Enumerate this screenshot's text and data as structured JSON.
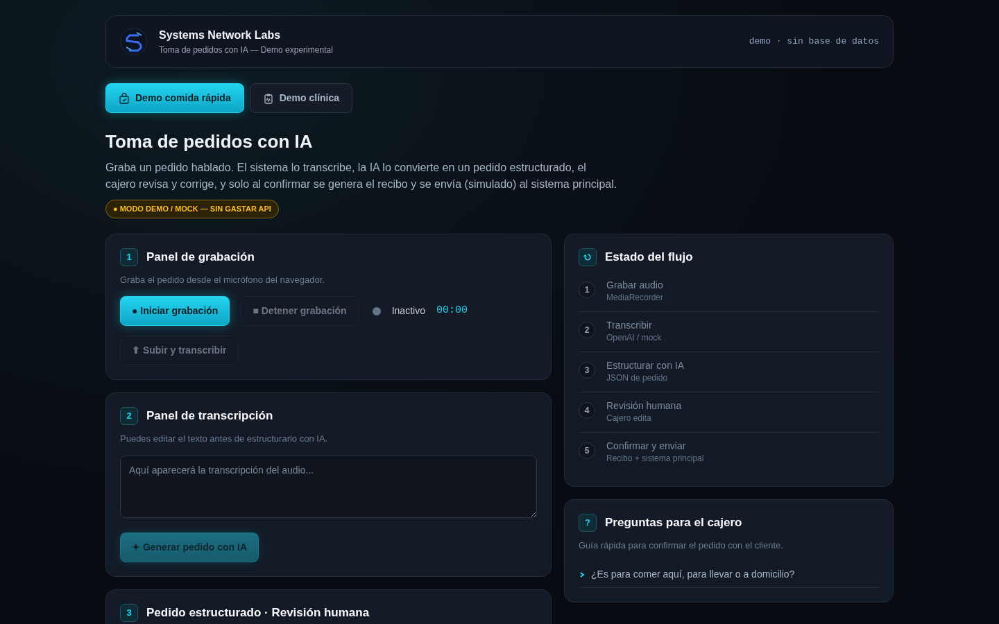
{
  "header": {
    "brand": "Systems Network Labs",
    "subtitle": "Toma de pedidos con IA — Demo experimental",
    "meta": "demo · sin base de datos"
  },
  "tabs": [
    {
      "label": "Demo comida rápida",
      "selected": true
    },
    {
      "label": "Demo clínica",
      "selected": false
    }
  ],
  "title": "Toma de pedidos con IA",
  "intro": "Graba un pedido hablado. El sistema lo transcribe, la IA lo convierte en un pedido estructurado, el cajero revisa y corrige, y solo al confirmar se genera el recibo y se envía (simulado) al sistema principal.",
  "demo_badge": "● MODO DEMO / MOCK — SIN GASTAR API",
  "recording_panel": {
    "number": "1",
    "title": "Panel de grabación",
    "description": "Graba el pedido desde el micrófono del navegador.",
    "buttons": [
      {
        "label": "● Iniciar grabación",
        "kind": "primary",
        "disabled": false
      },
      {
        "label": "■ Detener grabación",
        "kind": "secondary",
        "disabled": true
      }
    ],
    "status": {
      "label": "Inactivo",
      "recording": false,
      "timer": "00:00"
    },
    "upload_button": {
      "label": "⬆ Subir y transcribir",
      "disabled": true
    }
  },
  "transcription_panel": {
    "number": "2",
    "title": "Panel de transcripción",
    "description": "Puedes editar el texto antes de estructurarlo con IA.",
    "placeholder": "Aquí aparecerá la transcripción del audio...",
    "button": {
      "label": "✦ Generar pedido con IA",
      "kind": "primary",
      "disabled": true
    }
  },
  "order_panel": {
    "number": "3",
    "title": "Pedido estructurado · Revisión humana"
  },
  "flow_panel": {
    "title": "Estado del flujo",
    "steps": [
      {
        "number": "1",
        "title": "Grabar audio",
        "detail": "MediaRecorder"
      },
      {
        "number": "2",
        "title": "Transcribir",
        "detail": "OpenAI / mock"
      },
      {
        "number": "3",
        "title": "Estructurar con IA",
        "detail": "JSON de pedido"
      },
      {
        "number": "4",
        "title": "Revisión humana",
        "detail": "Cajero edita"
      },
      {
        "number": "5",
        "title": "Confirmar y enviar",
        "detail": "Recibo + sistema principal"
      }
    ]
  },
  "questions_panel": {
    "icon_text": "?",
    "title": "Preguntas para el cajero",
    "description": "Guía rápida para confirmar el pedido con el cliente.",
    "questions": [
      "¿Es para comer aquí, para llevar o a domicilio?"
    ]
  }
}
